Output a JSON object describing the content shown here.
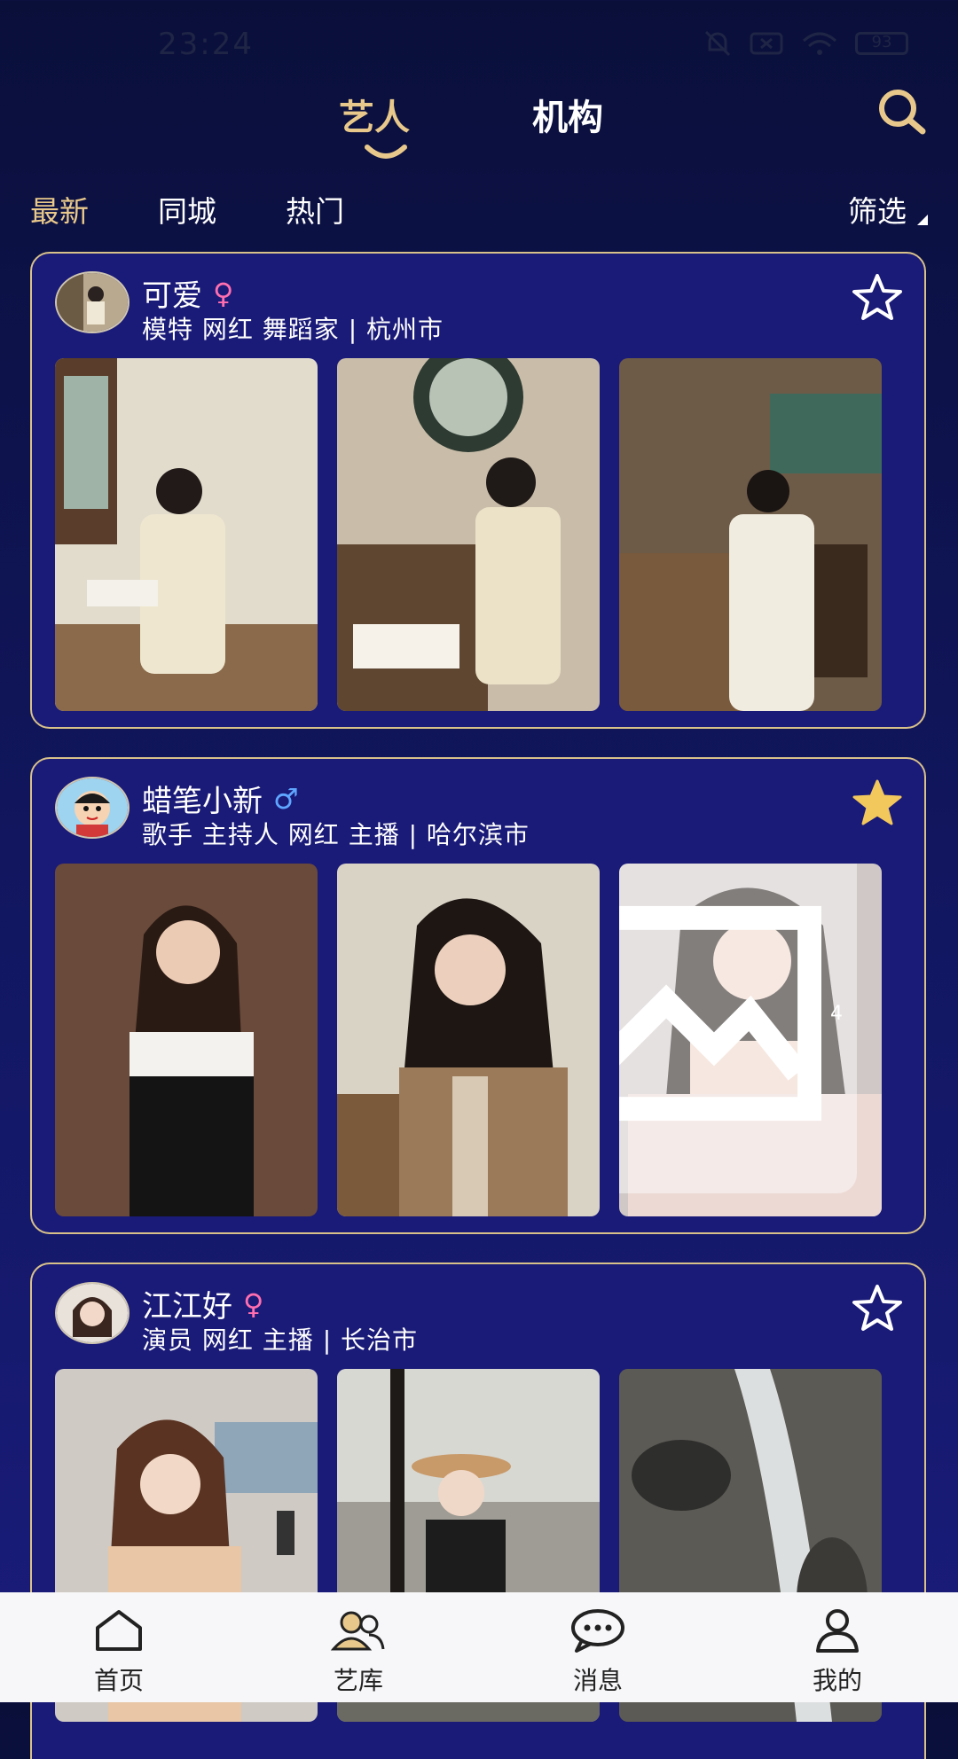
{
  "status": {
    "time": "23:24",
    "battery": "93"
  },
  "top_tabs": {
    "artist": "艺人",
    "organization": "机构"
  },
  "sub_tabs": {
    "latest": "最新",
    "same_city": "同城",
    "hot": "热门",
    "filter": "筛选"
  },
  "cards": [
    {
      "name": "可爱",
      "gender": "♀",
      "tags": "模特 网红 舞蹈家 | 杭州市",
      "favorited": false
    },
    {
      "name": "蜡笔小新",
      "gender": "♂",
      "tags": "歌手 主持人 网红 主播 | 哈尔滨市",
      "favorited": true,
      "photo_count": "4"
    },
    {
      "name": "江江好",
      "gender": "♀",
      "tags": "演员 网红 主播 | 长治市",
      "favorited": false
    }
  ],
  "bottom_nav": {
    "home": "首页",
    "library": "艺库",
    "messages": "消息",
    "mine": "我的"
  },
  "colors": {
    "accent": "#e9c98b",
    "card_bg": "#1a1a78",
    "star_filled": "#f2c75c"
  }
}
